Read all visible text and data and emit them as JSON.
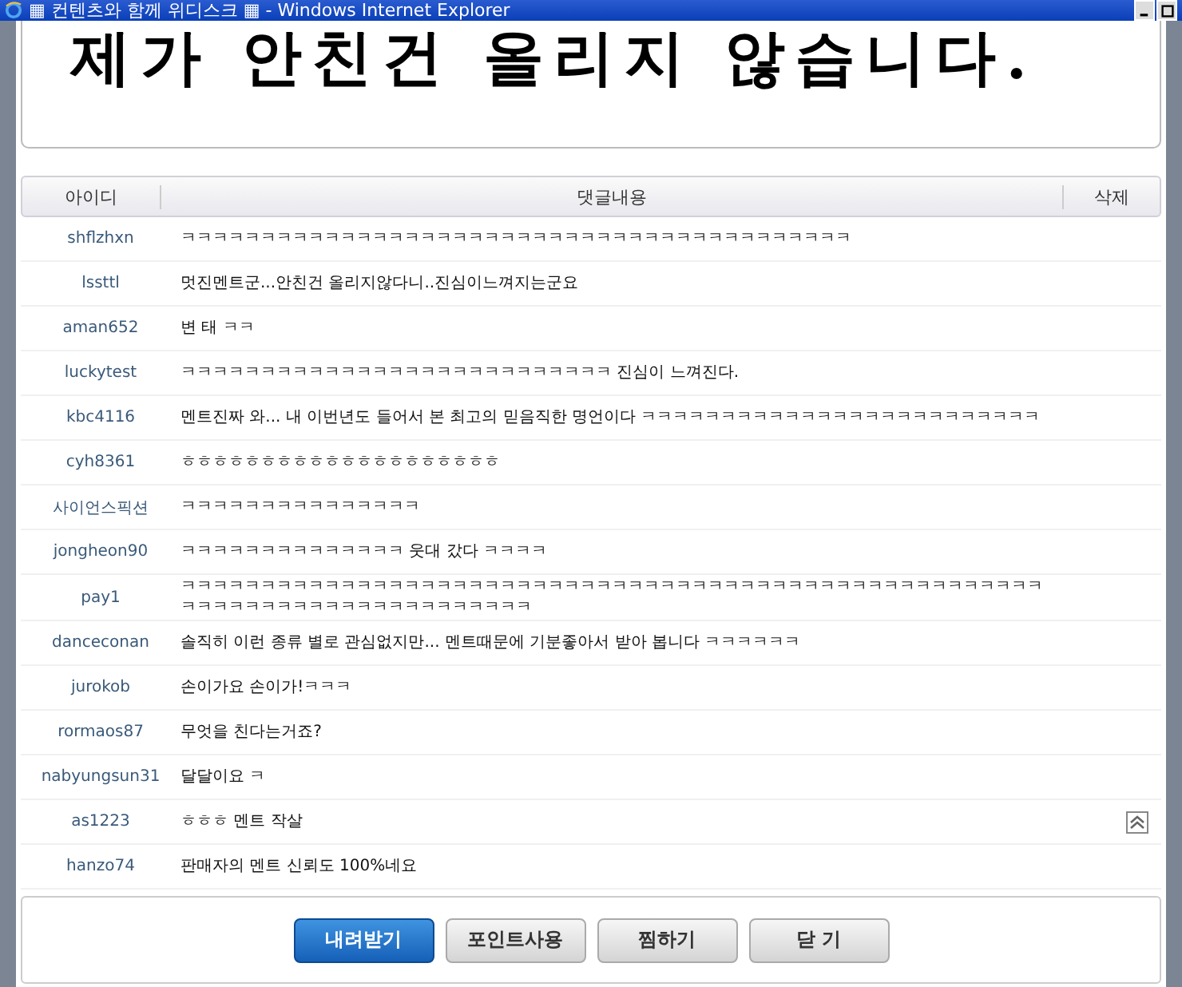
{
  "window": {
    "title": "▦ 컨텐츠와 함께 위디스크 ▦ - Windows Internet Explorer"
  },
  "message": "제가 안친건 올리지 않습니다.",
  "table": {
    "columns": [
      "아이디",
      "댓글내용",
      "삭제"
    ],
    "rows": [
      {
        "user": "shflzhxn",
        "comment": "ㅋㅋㅋㅋㅋㅋㅋㅋㅋㅋㅋㅋㅋㅋㅋㅋㅋㅋㅋㅋㅋㅋㅋㅋㅋㅋㅋㅋㅋㅋㅋㅋㅋㅋㅋㅋㅋㅋㅋㅋㅋㅋ"
      },
      {
        "user": "lssttl",
        "comment": "멋진멘트군...안친건 올리지않다니..진심이느껴지는군요"
      },
      {
        "user": "aman652",
        "comment": "변 태 ㅋㅋ"
      },
      {
        "user": "luckytest",
        "comment": "ㅋㅋㅋㅋㅋㅋㅋㅋㅋㅋㅋㅋㅋㅋㅋㅋㅋㅋㅋㅋㅋㅋㅋㅋㅋㅋㅋ 진심이 느껴진다."
      },
      {
        "user": "kbc4116",
        "comment": "멘트진짜 와... 내 이번년도 들어서 본 최고의 믿음직한 명언이다 ㅋㅋㅋㅋㅋㅋㅋㅋㅋㅋㅋㅋㅋㅋㅋㅋㅋㅋㅋㅋㅋㅋㅋㅋㅋ"
      },
      {
        "user": "cyh8361",
        "comment": "ㅎㅎㅎㅎㅎㅎㅎㅎㅎㅎㅎㅎㅎㅎㅎㅎㅎㅎㅎㅎ"
      },
      {
        "user": "사이언스픽션",
        "comment": "ㅋㅋㅋㅋㅋㅋㅋㅋㅋㅋㅋㅋㅋㅋㅋ"
      },
      {
        "user": "jongheon90",
        "comment": "ㅋㅋㅋㅋㅋㅋㅋㅋㅋㅋㅋㅋㅋㅋ 웃대 갔다 ㅋㅋㅋㅋ"
      },
      {
        "user": "pay1",
        "comment": "ㅋㅋㅋㅋㅋㅋㅋㅋㅋㅋㅋㅋㅋㅋㅋㅋㅋㅋㅋㅋㅋㅋㅋㅋㅋㅋㅋㅋㅋㅋㅋㅋㅋㅋㅋㅋㅋㅋㅋㅋㅋㅋㅋㅋㅋㅋㅋㅋㅋㅋㅋㅋㅋㅋㅋㅋㅋㅋㅋㅋㅋㅋㅋㅋㅋㅋㅋㅋㅋㅋㅋㅋㅋㅋㅋㅋ"
      },
      {
        "user": "danceconan",
        "comment": "솔직히 이런 종류 별로 관심없지만... 멘트때문에 기분좋아서 받아 봅니다 ㅋㅋㅋㅋㅋㅋ"
      },
      {
        "user": "jurokob",
        "comment": "손이가요 손이가!ㅋㅋㅋ"
      },
      {
        "user": "rormaos87",
        "comment": "무엇을 친다는거죠?"
      },
      {
        "user": "nabyungsun31",
        "comment": "달달이요 ㅋ"
      },
      {
        "user": "as1223",
        "comment": "ㅎㅎㅎ 멘트 작살"
      },
      {
        "user": "hanzo74",
        "comment": "판매자의 멘트 신뢰도 100%네요"
      }
    ]
  },
  "buttons": [
    {
      "label": "내려받기",
      "kind": "primary"
    },
    {
      "label": "포인트사용",
      "kind": "normal"
    },
    {
      "label": "찜하기",
      "kind": "normal"
    },
    {
      "label": "닫 기",
      "kind": "normal"
    }
  ]
}
